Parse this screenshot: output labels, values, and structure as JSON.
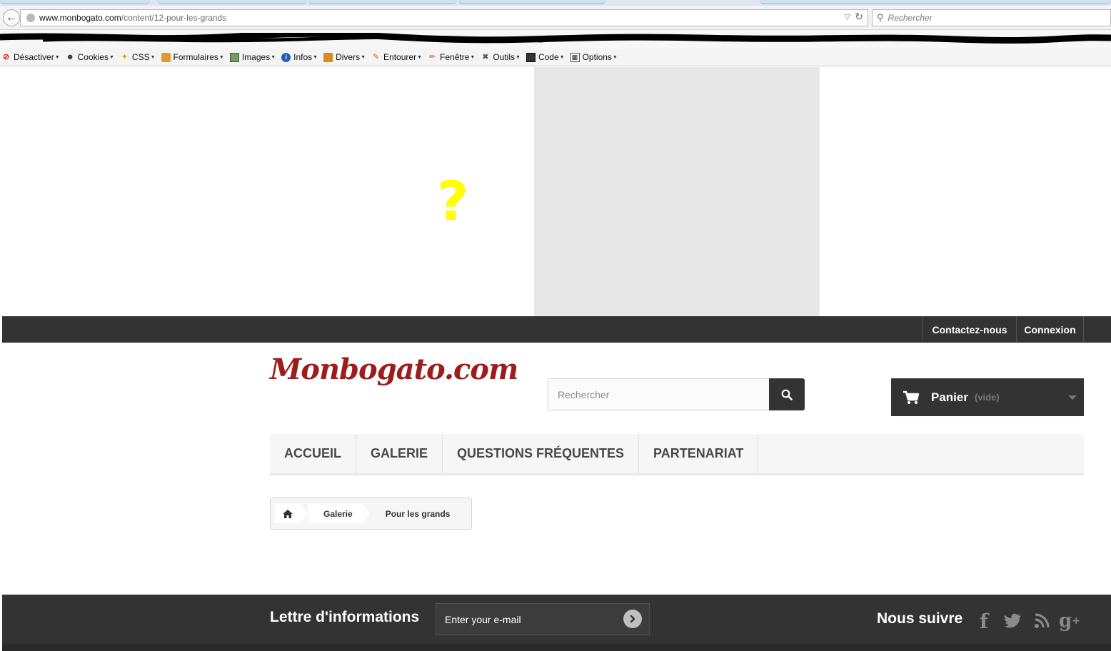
{
  "browser": {
    "url_domain": "www.monbogato.com",
    "url_path": "/content/12-pour-les-grands",
    "search_placeholder": "Rechercher"
  },
  "dev_toolbar": {
    "items": [
      {
        "label": "Désactiver",
        "icon": "disable-icon"
      },
      {
        "label": "Cookies",
        "icon": "cookie-icon"
      },
      {
        "label": "CSS",
        "icon": "css-icon"
      },
      {
        "label": "Formulaires",
        "icon": "forms-icon"
      },
      {
        "label": "Images",
        "icon": "images-icon"
      },
      {
        "label": "Infos",
        "icon": "info-icon"
      },
      {
        "label": "Divers",
        "icon": "misc-icon"
      },
      {
        "label": "Entourer",
        "icon": "outline-icon"
      },
      {
        "label": "Fenêtre",
        "icon": "window-icon"
      },
      {
        "label": "Outils",
        "icon": "tools-icon"
      },
      {
        "label": "Code",
        "icon": "code-icon"
      },
      {
        "label": "Options",
        "icon": "options-icon"
      }
    ]
  },
  "banner": {
    "annotation": "?"
  },
  "header": {
    "contact_label": "Contactez-nous",
    "login_label": "Connexion",
    "logo_text": "Monbogato.com",
    "search_placeholder": "Rechercher",
    "cart_label": "Panier",
    "cart_status": "(vide)"
  },
  "menu": {
    "items": [
      "ACCUEIL",
      "GALERIE",
      "QUESTIONS FRÉQUENTES",
      "PARTENARIAT"
    ]
  },
  "breadcrumb": {
    "items": [
      "Galerie",
      "Pour les grands"
    ]
  },
  "footer": {
    "newsletter_title": "Lettre d'informations",
    "newsletter_placeholder": "Enter your e-mail",
    "follow_title": "Nous suivre",
    "social": [
      "facebook-icon",
      "twitter-icon",
      "rss-icon",
      "google-plus-icon"
    ]
  },
  "colors": {
    "dark_bar": "#333333",
    "logo": "#9d1d1d",
    "placeholder_gray": "#e7e7e7",
    "annotation": "#ffff00"
  }
}
